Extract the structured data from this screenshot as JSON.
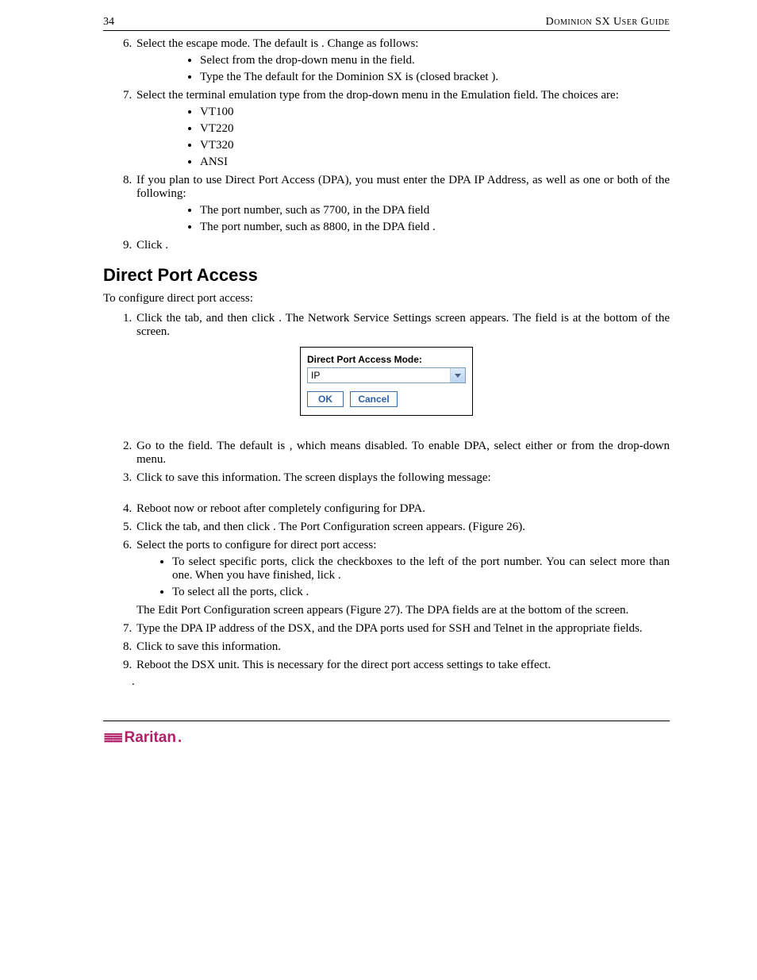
{
  "header": {
    "page_number": "34",
    "guide_title": "Dominion SX User Guide"
  },
  "listA": {
    "start": 6,
    "items": {
      "i6": {
        "text": "Select the escape mode. The default is       . Change as follows:",
        "sub": [
          "Select            from the drop-down menu in the                    field.",
          "Type the                               The default for the Dominion SX is   (closed bracket )."
        ]
      },
      "i7": {
        "text": "Select the terminal emulation type from the drop-down menu in the Emulation field. The choices are:",
        "sub": [
          "VT100",
          "VT220",
          "VT320",
          "ANSI"
        ]
      },
      "i8": {
        "text": "If you plan to use Direct Port Access (DPA), you must enter the DPA IP Address, as well as one or both of the following:",
        "sub": [
          "The port number, such as 7700, in the DPA                             field",
          "The port number, such as 8800, in the DPA                             field ."
        ]
      },
      "i9": {
        "text": "Click       ."
      }
    }
  },
  "section_heading": "Direct Port Access",
  "intro": "To configure direct port access:",
  "dialog": {
    "label": "Direct Port Access Mode:",
    "value": "IP",
    "ok": "OK",
    "cancel": "Cancel"
  },
  "listB": {
    "start": 1,
    "items": {
      "b1": "Click the          tab, and then click             . The Network Service Settings screen appears. The                                      field is at the bottom of the screen.",
      "b2": "Go to the                                       field. The default is            , which means disabled. To enable DPA, select either     or              from the drop-down menu.",
      "b3": "Click       to save this information. The screen displays the following message:",
      "b4": "Reboot now or reboot after completely configuring for DPA.",
      "b5": "Click the           tab, and then click                          . The Port Configuration screen appears. (Figure 26).",
      "b6": {
        "text": "Select the ports to configure for direct port access:",
        "sub": [
          "To select specific ports, click the checkboxes to the left of the port number. You can select more than one. When you have finished, lick        .",
          "To select all the ports, click                ."
        ],
        "tail": "The Edit Port Configuration screen appears (Figure 27). The DPA fields are at the bottom of the screen."
      },
      "b7": "Type the DPA IP address of the DSX, and the DPA ports used for SSH and Telnet in the appropriate fields.",
      "b8": "Click      to save this information.",
      "b9": "Reboot the DSX unit. This is necessary for the direct port access settings to take effect."
    }
  },
  "orphan_dot": ".",
  "logo": {
    "glyph": "≣≣",
    "text": "Raritan",
    "dot": "."
  }
}
